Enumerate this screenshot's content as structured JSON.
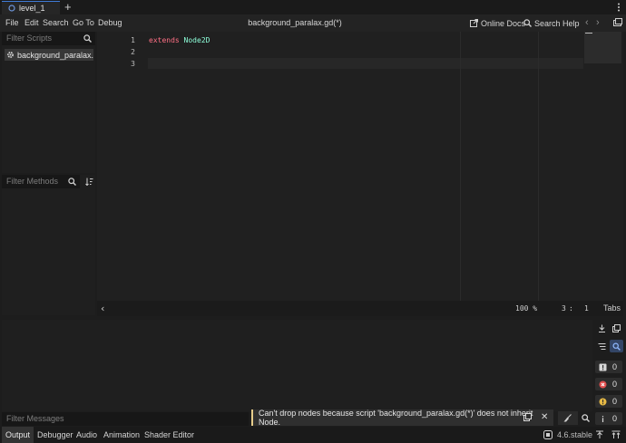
{
  "tabbar": {
    "scene_tab_label": "level_1",
    "add_tab_symbol": "+"
  },
  "toolbar": {
    "menus": [
      "File",
      "Edit",
      "Search",
      "Go To",
      "Debug"
    ],
    "document_title": "background_paralax.gd(*)",
    "online_docs_label": "Online Docs",
    "search_help_label": "Search Help"
  },
  "scripts_panel": {
    "filter_placeholder": "Filter Scripts",
    "items": [
      {
        "label": "background_paralax.g..."
      }
    ]
  },
  "methods_panel": {
    "filter_placeholder": "Filter Methods"
  },
  "editor": {
    "line_numbers": [
      "1",
      "2",
      "3"
    ],
    "code": {
      "keyword": "extends",
      "type": "Node2D"
    },
    "current_line": 3
  },
  "status_bar": {
    "zoom": "100 %",
    "line": "3",
    "separator": ":",
    "column": "1",
    "indent_mode": "Tabs"
  },
  "output_panel": {
    "filter_placeholder": "Filter Messages",
    "counts": {
      "messages": "0",
      "errors": "0",
      "warnings": "0",
      "info": "0"
    },
    "toast_message": "Can't drop nodes because script 'background_paralax.gd(*)' does not inherit Node."
  },
  "bottom_tabs": [
    "Output",
    "Debugger",
    "Audio",
    "Animation",
    "Shader Editor"
  ],
  "version": "4.6.stable",
  "colors": {
    "accent": "#3f7bd8",
    "keyword": "#ff7085",
    "type": "#8effda",
    "error": "#e25050",
    "warning": "#e6b945",
    "toast_border": "#e6cc8a"
  }
}
